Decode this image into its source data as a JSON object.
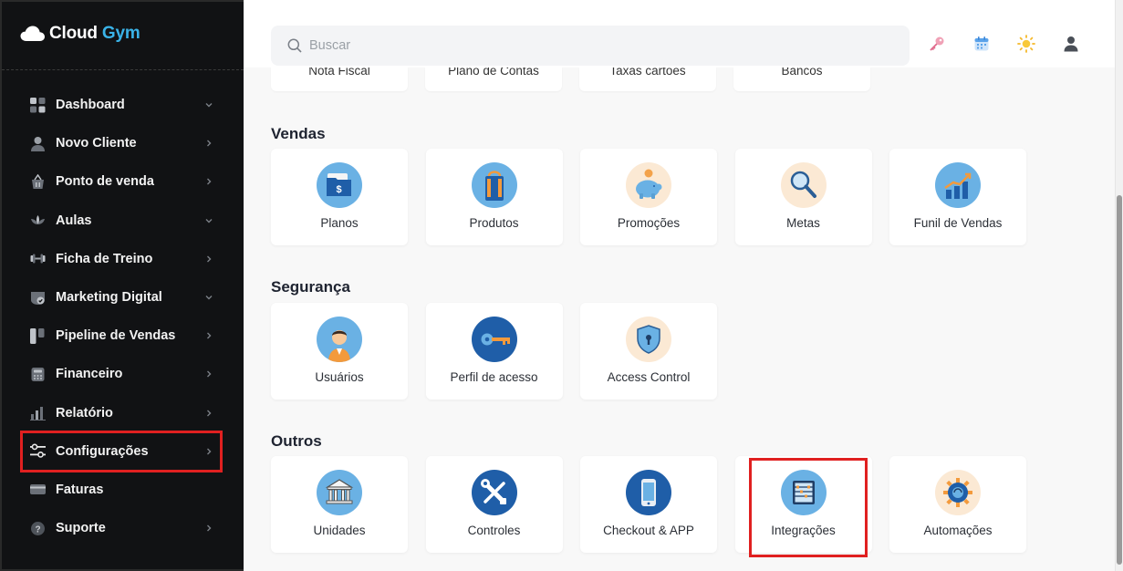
{
  "brand": {
    "cloud": "Cloud",
    "gym": "Gym"
  },
  "sidebar": {
    "items": [
      {
        "label": "Dashboard",
        "icon": "dashboard-grid-icon",
        "chevron": "down"
      },
      {
        "label": "Novo Cliente",
        "icon": "user-icon",
        "chevron": "right"
      },
      {
        "label": "Ponto de venda",
        "icon": "basket-icon",
        "chevron": "right"
      },
      {
        "label": "Aulas",
        "icon": "lotus-icon",
        "chevron": "down"
      },
      {
        "label": "Ficha de Treino",
        "icon": "dumbbell-icon",
        "chevron": "right"
      },
      {
        "label": "Marketing Digital",
        "icon": "badge-check-icon",
        "chevron": "down"
      },
      {
        "label": "Pipeline de Vendas",
        "icon": "pipeline-icon",
        "chevron": "right"
      },
      {
        "label": "Financeiro",
        "icon": "calculator-icon",
        "chevron": "right"
      },
      {
        "label": "Relatório",
        "icon": "bar-chart-icon",
        "chevron": "right"
      },
      {
        "label": "Configurações",
        "icon": "sliders-icon",
        "chevron": "right"
      },
      {
        "label": "Faturas",
        "icon": "card-icon",
        "chevron": "none"
      },
      {
        "label": "Suporte",
        "icon": "help-icon",
        "chevron": "right"
      }
    ]
  },
  "search": {
    "placeholder": "Buscar"
  },
  "topbar_icons": [
    "key-icon",
    "calendar-icon",
    "sun-icon",
    "user-profile-icon"
  ],
  "partial_cards": [
    "Nota Fiscal",
    "Plano de Contas",
    "Taxas cartões",
    "Bancos"
  ],
  "sections": [
    {
      "title": "Vendas",
      "cards": [
        "Planos",
        "Produtos",
        "Promoções",
        "Metas",
        "Funil de Vendas"
      ]
    },
    {
      "title": "Segurança",
      "cards": [
        "Usuários",
        "Perfil de acesso",
        "Access Control"
      ]
    },
    {
      "title": "Outros",
      "cards": [
        "Unidades",
        "Controles",
        "Checkout & APP",
        "Integrações",
        "Automações"
      ]
    }
  ],
  "colors": {
    "highlight": "#e02020",
    "brand_accent": "#3ab3e8",
    "sidebar_bg": "#111214"
  }
}
